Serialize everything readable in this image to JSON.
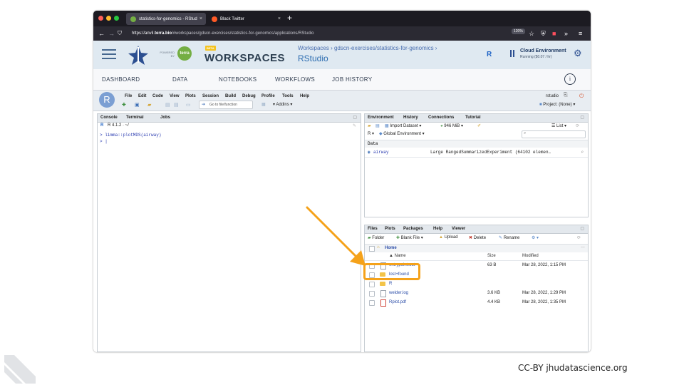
{
  "browser": {
    "tabs": [
      {
        "label": "statistics-for-genomics - RStud",
        "close": "×"
      },
      {
        "label": "Black Twitter",
        "close": "×"
      }
    ],
    "new_tab": "+",
    "url_prefix": "https://anvil.",
    "url_domain": "terra.bio",
    "url_suffix": "/#workspaces/gdscn-exercises/statistics-for-genomics/applications/RStudio",
    "zoom": "120%"
  },
  "terra": {
    "powered_by": "POWERED BY",
    "terra_badge": "terra",
    "beta": "BETA",
    "workspaces": "WORKSPACES",
    "breadcrumb": "Workspaces › gdscn-exercises/statistics-for-genomics ›",
    "app_name": "RStudio",
    "cloud_title": "Cloud Environment",
    "cloud_status": "Running ($0.07 / hr)",
    "nav": [
      "DASHBOARD",
      "DATA",
      "NOTEBOOKS",
      "WORKFLOWS",
      "JOB HISTORY"
    ],
    "info_icon": "i"
  },
  "rstudio": {
    "menu": [
      "File",
      "Edit",
      "Code",
      "View",
      "Plots",
      "Session",
      "Build",
      "Debug",
      "Profile",
      "Tools",
      "Help"
    ],
    "goto_placeholder": "Go to file/function",
    "addins": "Addins",
    "user": "rstudio",
    "project": "Project: (None)",
    "console_tabs": [
      "Console",
      "Terminal",
      "Jobs"
    ],
    "r_version": "R 4.1.2 · ~/",
    "console_lines": [
      "> limma::plotMDS(airway)",
      "> |"
    ],
    "env_tabs": [
      "Environment",
      "History",
      "Connections",
      "Tutorial"
    ],
    "import_dataset": "Import Dataset",
    "memory": "946 MiB",
    "list_label": "List",
    "r_label": "R",
    "global_env": "Global Environment",
    "data_header": "Data",
    "env_var_name": "airway",
    "env_var_value": "Large RangedSummarizedExperiment (64102 elemen…",
    "files_tabs": [
      "Files",
      "Plots",
      "Packages",
      "Help",
      "Viewer"
    ],
    "files_toolbar": [
      "Folder",
      "Blank File",
      "Upload",
      "Delete",
      "Rename"
    ],
    "home_label": "Home",
    "col_name": "▲ Name",
    "col_size": "Size",
    "col_modified": "Modified",
    "files": [
      {
        "name": "entrypoint.out",
        "size": "63 B",
        "modified": "Mar 28, 2022, 1:15 PM",
        "type": "file"
      },
      {
        "name": "lost+found",
        "size": "",
        "modified": "",
        "type": "folder"
      },
      {
        "name": "R",
        "size": "",
        "modified": "",
        "type": "folder"
      },
      {
        "name": "welder.log",
        "size": "3.6 KB",
        "modified": "Mar 28, 2022, 1:29 PM",
        "type": "file"
      },
      {
        "name": "Rplot.pdf",
        "size": "4.4 KB",
        "modified": "Mar 28, 2022, 1:35 PM",
        "type": "pdf"
      }
    ]
  },
  "footer": {
    "credit": "CC-BY jhudatascience.org"
  },
  "colors": {
    "highlight": "#f5a21a",
    "terra_green": "#74ae43",
    "link": "#2b4da8"
  }
}
